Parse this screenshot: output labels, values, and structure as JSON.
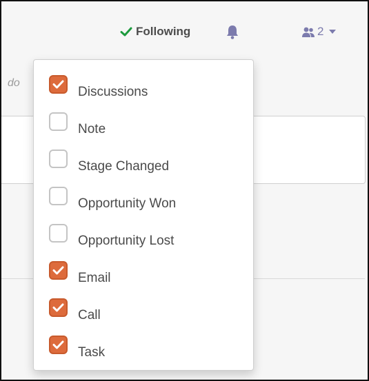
{
  "header": {
    "following_label": "Following",
    "followers_count": "2",
    "follow_check_color": "#1c9a3d",
    "accent_color": "#7c7bad",
    "icons": {
      "following": "check-icon",
      "notifications": "bell-icon",
      "followers": "users-icon",
      "menu": "caret-down-icon"
    }
  },
  "background": {
    "snippet_text": "do"
  },
  "subtypes_menu": {
    "checked_color": "#dd6b3c",
    "items": [
      {
        "label": "Discussions",
        "checked": true
      },
      {
        "label": "Note",
        "checked": false
      },
      {
        "label": "Stage Changed",
        "checked": false
      },
      {
        "label": "Opportunity Won",
        "checked": false
      },
      {
        "label": "Opportunity Lost",
        "checked": false
      },
      {
        "label": "Email",
        "checked": true
      },
      {
        "label": "Call",
        "checked": true
      },
      {
        "label": "Task",
        "checked": true
      }
    ]
  }
}
